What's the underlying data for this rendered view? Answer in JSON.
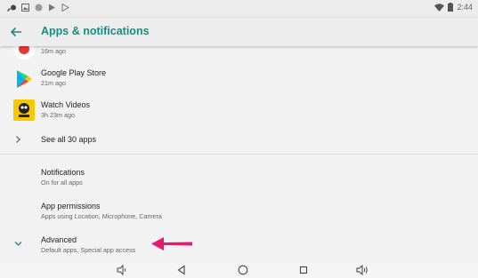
{
  "status_bar": {
    "time": "2:44",
    "left_icons": [
      "cast-icon",
      "image-icon",
      "circle-icon",
      "play-icon",
      "play-store-icon"
    ],
    "right_icons": [
      "wifi-icon",
      "battery-icon"
    ]
  },
  "app_bar": {
    "title": "Apps & notifications",
    "back_icon": "arrow-back-icon"
  },
  "recent_apps": [
    {
      "name": "",
      "time": "16m ago",
      "icon": "partially-hidden-app-icon"
    },
    {
      "name": "Google Play Store",
      "time": "21m ago",
      "icon": "play-store-icon"
    },
    {
      "name": "Watch Videos",
      "time": "3h 23m ago",
      "icon": "watch-videos-icon"
    }
  ],
  "see_all": {
    "label": "See all 30 apps",
    "icon": "chevron-right-icon"
  },
  "settings": [
    {
      "title": "Notifications",
      "subtitle": "On for all apps"
    },
    {
      "title": "App permissions",
      "subtitle": "Apps using Location, Microphone, Camera"
    },
    {
      "title": "Advanced",
      "subtitle": "Default apps, Special app access",
      "icon": "chevron-down-icon"
    }
  ],
  "annotation": {
    "icon": "pointer-arrow-icon",
    "color": "#e8196f"
  },
  "nav_bar": [
    "volume-down-icon",
    "back-icon",
    "home-icon",
    "recents-icon",
    "volume-up-icon"
  ],
  "colors": {
    "accent": "#1d8a80",
    "annotation": "#e8196f"
  }
}
